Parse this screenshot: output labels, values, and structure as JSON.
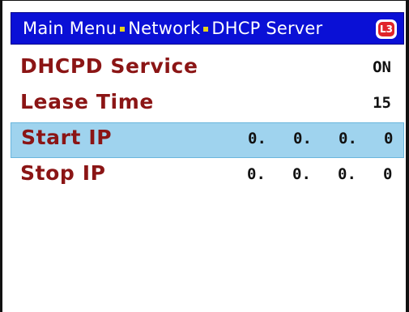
{
  "header": {
    "breadcrumb": [
      "Main Menu",
      "Network",
      "DHCP Server"
    ],
    "level_badge": "L3",
    "background_color": "#0a10d6",
    "separator_color": "#e7d21b",
    "badge_color": "#e0242a"
  },
  "menu": {
    "label_color": "#8b1515",
    "selected_row_color": "#9fd3ee",
    "selected_index": 2,
    "items": [
      {
        "label": "DHCPD Service",
        "value": "ON"
      },
      {
        "label": "Lease Time",
        "value": "15"
      },
      {
        "label": "Start IP",
        "octets": [
          "0.",
          "0.",
          "0.",
          "0"
        ]
      },
      {
        "label": "Stop IP",
        "octets": [
          "0.",
          "0.",
          "0.",
          "0"
        ]
      }
    ]
  }
}
